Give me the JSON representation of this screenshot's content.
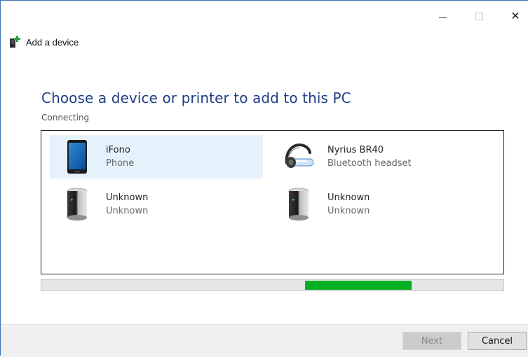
{
  "window": {
    "title": "Add a device",
    "controls": {
      "minimize": "minimize",
      "maximize": "maximize",
      "close": "✕"
    }
  },
  "main": {
    "heading": "Choose a device or printer to add to this PC",
    "status": "Connecting",
    "devices": [
      {
        "name": "iFono",
        "type": "Phone",
        "icon": "phone-icon",
        "selected": true
      },
      {
        "name": "Nyrius BR40",
        "type": "Bluetooth headset",
        "icon": "headset-icon",
        "selected": false
      },
      {
        "name": "Unknown",
        "type": "Unknown",
        "icon": "device-tower-icon",
        "selected": false
      },
      {
        "name": "Unknown",
        "type": "Unknown",
        "icon": "device-tower-icon",
        "selected": false
      }
    ],
    "progress": {
      "mode": "indeterminate",
      "color": "#06b025"
    }
  },
  "footer": {
    "next_label": "Next",
    "cancel_label": "Cancel"
  },
  "colors": {
    "heading": "#1f3f86",
    "selection": "#e5f1fb",
    "border": "#3c6fb3"
  }
}
